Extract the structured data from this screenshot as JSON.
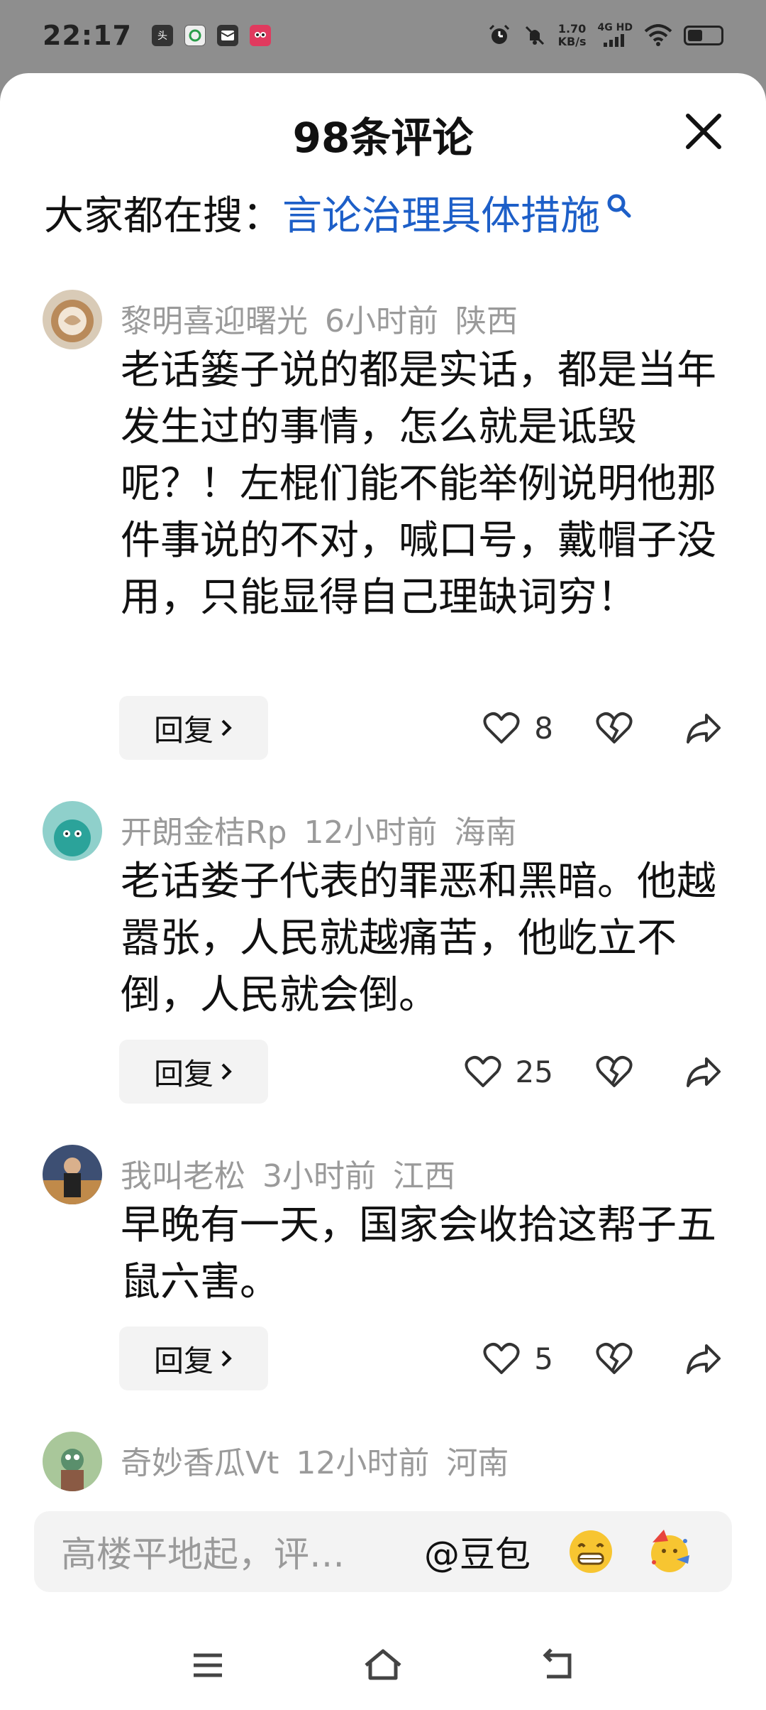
{
  "status_bar": {
    "time": "22:17",
    "net_speed_value": "1.70",
    "net_speed_unit": "KB/s",
    "signal_label": "4G HD",
    "icons": [
      "toutiao-icon",
      "mobile-icon",
      "mail-icon",
      "app-icon",
      "alarm-icon",
      "mute-icon",
      "signal-icon",
      "wifi-icon",
      "battery-icon"
    ]
  },
  "sheet": {
    "title": "98条评论",
    "search_prefix": "大家都在搜：",
    "search_term": "言论治理具体措施"
  },
  "comments": [
    {
      "user": "黎明喜迎曙光",
      "time": "6小时前",
      "location": "陕西",
      "text": "老话篓子说的都是实话，都是当年发生过的事情，怎么就是诋毁呢？！左棍们能不能举例说明他那件事说的不对，喊口号，戴帽子没用，只能显得自己理缺词穷！",
      "reply_label": "回复",
      "likes": "8"
    },
    {
      "user": "开朗金桔Rp",
      "time": "12小时前",
      "location": "海南",
      "text": "老话娄子代表的罪恶和黑暗。他越嚣张，人民就越痛苦，他屹立不倒，人民就会倒。",
      "reply_label": "回复",
      "likes": "25"
    },
    {
      "user": "我叫老松",
      "time": "3小时前",
      "location": "江西",
      "text": "早晚有一天，国家会收拾这帮子五鼠六害。",
      "reply_label": "回复",
      "likes": "5"
    },
    {
      "user": "奇妙香瓜Vt",
      "time": "12小时前",
      "location": "河南"
    }
  ],
  "input_bar": {
    "placeholder": "高楼平地起，评…",
    "mention": "@豆包"
  },
  "colors": {
    "accent_link": "#1d5fc8",
    "meta_gray": "#9a9a9a",
    "chip_bg": "#f3f3f3"
  }
}
